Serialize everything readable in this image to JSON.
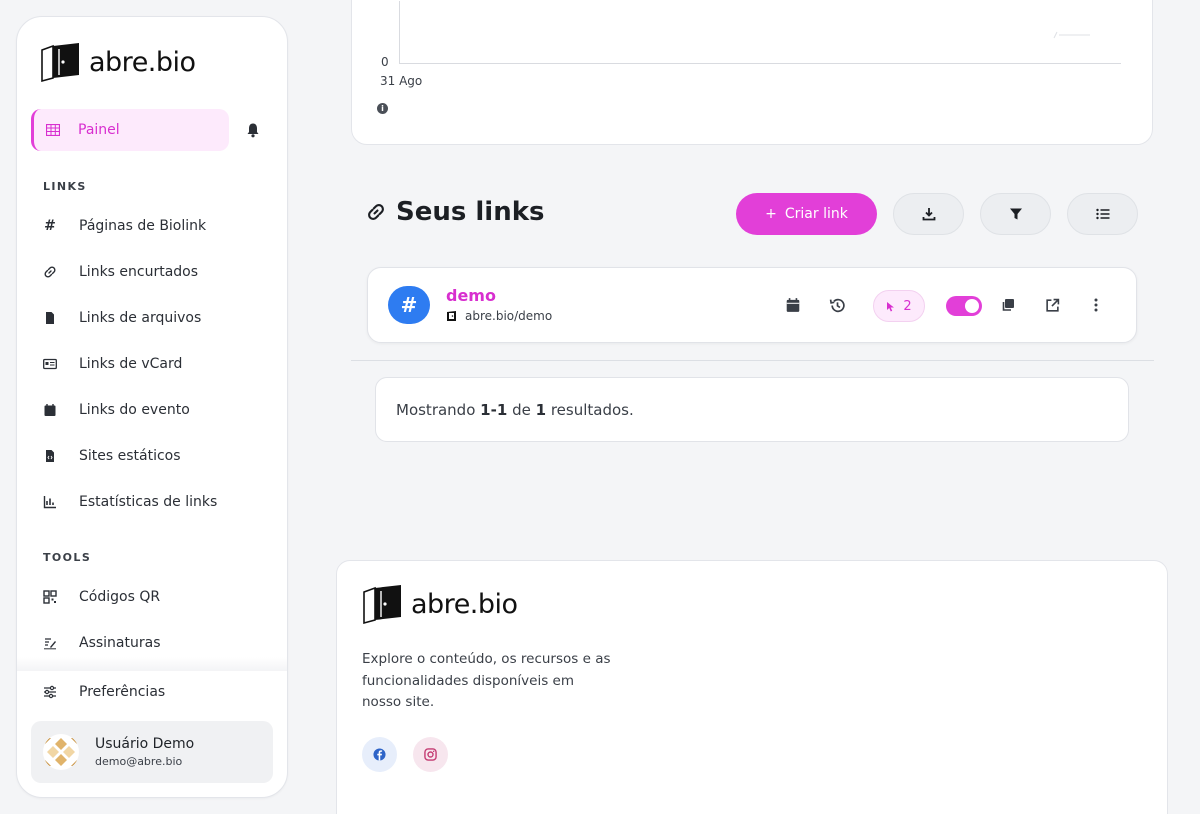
{
  "brand": {
    "name": "abre.bio"
  },
  "sidebar": {
    "active": {
      "label": "Painel"
    },
    "sections": [
      {
        "title": "LINKS"
      },
      {
        "title": "TOOLS"
      }
    ],
    "links_items": [
      {
        "label": "Páginas de Biolink",
        "icon": "hash-icon"
      },
      {
        "label": "Links encurtados",
        "icon": "link-icon"
      },
      {
        "label": "Links de arquivos",
        "icon": "file-icon"
      },
      {
        "label": "Links de vCard",
        "icon": "id-card-icon"
      },
      {
        "label": "Links do evento",
        "icon": "calendar-icon"
      },
      {
        "label": "Sites estáticos",
        "icon": "file-code-icon"
      },
      {
        "label": "Estatísticas de links",
        "icon": "chart-icon"
      }
    ],
    "tools_items": [
      {
        "label": "Códigos QR",
        "icon": "qr-icon"
      },
      {
        "label": "Assinaturas",
        "icon": "signature-icon"
      }
    ],
    "preferences": {
      "label": "Preferências"
    },
    "user": {
      "name": "Usuário Demo",
      "email": "demo@abre.bio"
    }
  },
  "chart": {
    "y_tick": "0",
    "x_tick": "31 Ago"
  },
  "links_section": {
    "title": "Seus links",
    "create_label": "Criar link",
    "create_prefix": "+"
  },
  "link_row": {
    "badge": "#",
    "name": "demo",
    "url": "abre.bio/demo",
    "clicks": "2",
    "enabled": true
  },
  "pager": {
    "prefix": "Mostrando",
    "range": "1-1",
    "middle": "de",
    "total": "1",
    "suffix": "resultados."
  },
  "footer": {
    "description": "Explore o conteúdo, os recursos e as funcionalidades disponíveis em nosso site."
  },
  "colors": {
    "accent": "#e23fd8",
    "badge_blue": "#2e7cf1"
  }
}
